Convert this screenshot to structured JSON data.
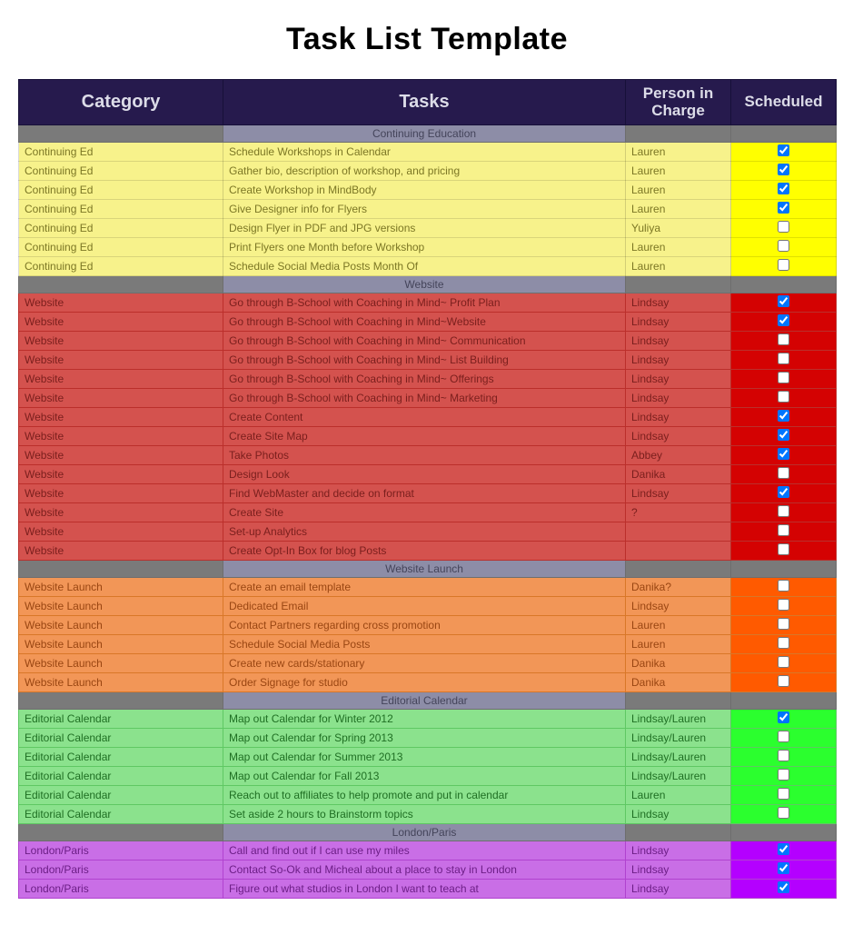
{
  "title": "Task List Template",
  "headers": {
    "category": "Category",
    "tasks": "Tasks",
    "person": "Person in Charge",
    "scheduled": "Scheduled"
  },
  "sections": [
    {
      "label": "Continuing Education",
      "class": "sec-yellow",
      "rows": [
        {
          "cat": "Continuing Ed",
          "task": "Schedule Workshops in Calendar",
          "who": "Lauren",
          "done": true
        },
        {
          "cat": "Continuing Ed",
          "task": "Gather bio, description of workshop, and pricing",
          "who": "Lauren",
          "done": true
        },
        {
          "cat": "Continuing Ed",
          "task": "Create Workshop in MindBody",
          "who": "Lauren",
          "done": true
        },
        {
          "cat": "Continuing Ed",
          "task": "Give Designer info for Flyers",
          "who": "Lauren",
          "done": true
        },
        {
          "cat": "Continuing Ed",
          "task": "Design Flyer in PDF and JPG versions",
          "who": "Yuliya",
          "done": false
        },
        {
          "cat": "Continuing Ed",
          "task": "Print Flyers one Month before Workshop",
          "who": "Lauren",
          "done": false
        },
        {
          "cat": "Continuing Ed",
          "task": "Schedule Social Media Posts Month Of",
          "who": "Lauren",
          "done": false
        }
      ]
    },
    {
      "label": "Website",
      "class": "sec-red",
      "rows": [
        {
          "cat": "Website",
          "task": "Go through B-School with Coaching in Mind~ Profit Plan",
          "who": "Lindsay",
          "done": true
        },
        {
          "cat": "Website",
          "task": "Go through B-School with Coaching in Mind~Website",
          "who": "Lindsay",
          "done": true
        },
        {
          "cat": "Website",
          "task": "Go through B-School with Coaching in Mind~ Communication",
          "who": "Lindsay",
          "done": false
        },
        {
          "cat": "Website",
          "task": "Go through B-School with Coaching in Mind~ List Building",
          "who": "Lindsay",
          "done": false
        },
        {
          "cat": "Website",
          "task": "Go through B-School with Coaching in Mind~ Offerings",
          "who": "Lindsay",
          "done": false
        },
        {
          "cat": "Website",
          "task": "Go through B-School with Coaching in Mind~ Marketing",
          "who": "Lindsay",
          "done": false
        },
        {
          "cat": "Website",
          "task": "Create Content",
          "who": "Lindsay",
          "done": true
        },
        {
          "cat": "Website",
          "task": "Create Site Map",
          "who": "Lindsay",
          "done": true
        },
        {
          "cat": "Website",
          "task": "Take Photos",
          "who": "Abbey",
          "done": true
        },
        {
          "cat": "Website",
          "task": "Design Look",
          "who": "Danika",
          "done": false
        },
        {
          "cat": "Website",
          "task": "Find WebMaster and decide on format",
          "who": "Lindsay",
          "done": true
        },
        {
          "cat": "Website",
          "task": "Create Site",
          "who": "?",
          "done": false
        },
        {
          "cat": "Website",
          "task": "Set-up Analytics",
          "who": "",
          "done": false
        },
        {
          "cat": "Website",
          "task": "Create Opt-In Box for blog Posts",
          "who": "",
          "done": false
        }
      ]
    },
    {
      "label": "Website Launch",
      "class": "sec-orange",
      "rows": [
        {
          "cat": "Website Launch",
          "task": "Create an email template",
          "who": "Danika?",
          "done": false
        },
        {
          "cat": "Website Launch",
          "task": "Dedicated Email",
          "who": "Lindsay",
          "done": false
        },
        {
          "cat": "Website Launch",
          "task": "Contact Partners regarding cross promotion",
          "who": "Lauren",
          "done": false
        },
        {
          "cat": "Website Launch",
          "task": "Schedule Social Media Posts",
          "who": "Lauren",
          "done": false
        },
        {
          "cat": "Website Launch",
          "task": "Create new cards/stationary",
          "who": "Danika",
          "done": false
        },
        {
          "cat": "Website Launch",
          "task": "Order Signage for studio",
          "who": "Danika",
          "done": false
        }
      ]
    },
    {
      "label": "Editorial Calendar",
      "class": "sec-green",
      "rows": [
        {
          "cat": "Editorial Calendar",
          "task": "Map out Calendar for Winter 2012",
          "who": "Lindsay/Lauren",
          "done": true
        },
        {
          "cat": "Editorial Calendar",
          "task": "Map out Calendar for Spring 2013",
          "who": "Lindsay/Lauren",
          "done": false
        },
        {
          "cat": "Editorial Calendar",
          "task": "Map out Calendar for Summer 2013",
          "who": "Lindsay/Lauren",
          "done": false
        },
        {
          "cat": "Editorial Calendar",
          "task": "Map out Calendar for Fall 2013",
          "who": "Lindsay/Lauren",
          "done": false
        },
        {
          "cat": "Editorial Calendar",
          "task": "Reach out to affiliates to help promote and put in calendar",
          "who": "Lauren",
          "done": false
        },
        {
          "cat": "Editorial Calendar",
          "task": "Set aside 2 hours to Brainstorm topics",
          "who": "Lindsay",
          "done": false
        }
      ]
    },
    {
      "label": "London/Paris",
      "class": "sec-purple",
      "rows": [
        {
          "cat": "London/Paris",
          "task": "Call and find out if I can use my miles",
          "who": "Lindsay",
          "done": true
        },
        {
          "cat": "London/Paris",
          "task": "Contact So-Ok and Micheal about a place to stay in London",
          "who": "Lindsay",
          "done": true
        },
        {
          "cat": "London/Paris",
          "task": "Figure out what studios in London I want to teach at",
          "who": "Lindsay",
          "done": true
        }
      ]
    }
  ]
}
